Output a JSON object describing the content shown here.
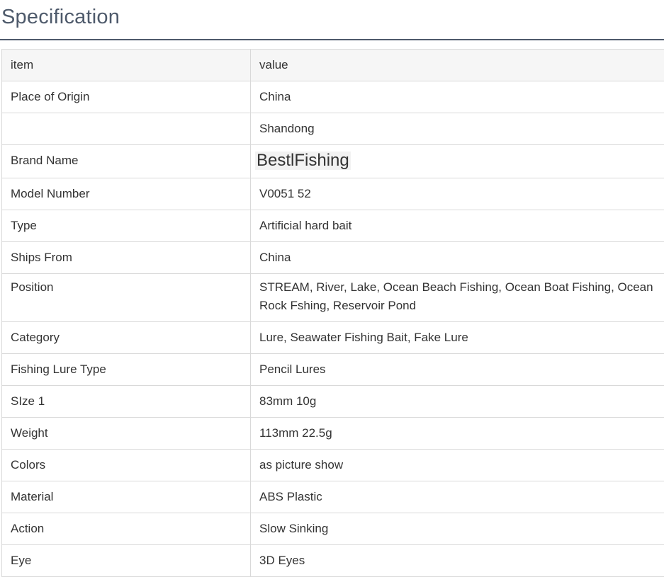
{
  "page": {
    "title": "Specification"
  },
  "table": {
    "header": {
      "item": "item",
      "value": "value"
    },
    "rows": [
      {
        "item": "Place of Origin",
        "value": "China"
      },
      {
        "item": "",
        "value": "Shandong"
      },
      {
        "item": "Brand Name",
        "value": "BestlFishing"
      },
      {
        "item": "Model Number",
        "value": "V0051 52"
      },
      {
        "item": "Type",
        "value": "Artificial hard bait"
      },
      {
        "item": "Ships From",
        "value": "China"
      },
      {
        "item": "Position",
        "value": "STREAM, River, Lake, Ocean Beach Fishing, Ocean Boat Fishing, Ocean Rock Fshing, Reservoir Pond"
      },
      {
        "item": "Category",
        "value": "Lure, Seawater Fishing Bait, Fake Lure"
      },
      {
        "item": "Fishing Lure Type",
        "value": "Pencil Lures"
      },
      {
        "item": "SIze 1",
        "value": "83mm 10g"
      },
      {
        "item": "Weight",
        "value": "113mm 22.5g"
      },
      {
        "item": "Colors",
        "value": "as picture show"
      },
      {
        "item": "Material",
        "value": "ABS Plastic"
      },
      {
        "item": "Action",
        "value": "Slow Sinking"
      },
      {
        "item": "Eye",
        "value": "3D Eyes"
      }
    ]
  },
  "colors": {
    "title": "#4e5a6b",
    "border": "#d9d9d9",
    "header_bg": "#f6f6f6",
    "text": "#333333"
  }
}
